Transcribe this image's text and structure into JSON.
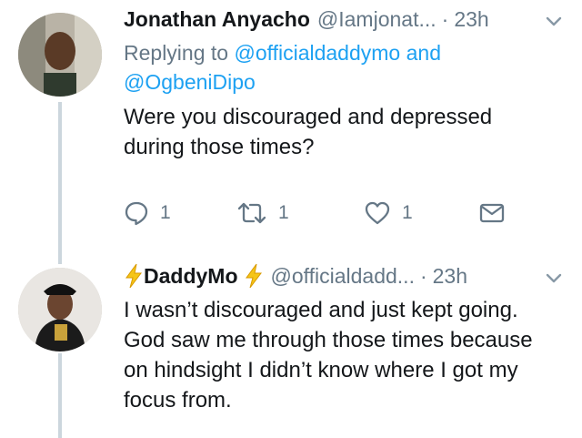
{
  "tweets": [
    {
      "name": "Jonathan Anyacho",
      "handle": "@Iamjonat...",
      "separator": "·",
      "time": "23h",
      "reply_prefix": "Replying to",
      "reply_mention_1": "@officialdaddymo",
      "reply_and": "and",
      "reply_mention_2": "@OgbeniDipo",
      "text": "Were you discouraged and depressed during those times?",
      "reply_count": "1",
      "retweet_count": "1",
      "like_count": "1"
    },
    {
      "name": "DaddyMo",
      "handle": "@officialdadd...",
      "separator": "·",
      "time": "23h",
      "text": "I wasn’t discouraged and just kept going. God saw me through those times because on hindsight I didn’t know where I got my focus from."
    }
  ],
  "colors": {
    "accent": "#1da1f2",
    "muted": "#657786",
    "thread_line": "#ccd6dd",
    "bolt": "#f5c518"
  },
  "icons": [
    "chevron-down-icon",
    "reply-icon",
    "retweet-icon",
    "like-icon",
    "message-icon",
    "lightning-emoji-icon"
  ]
}
